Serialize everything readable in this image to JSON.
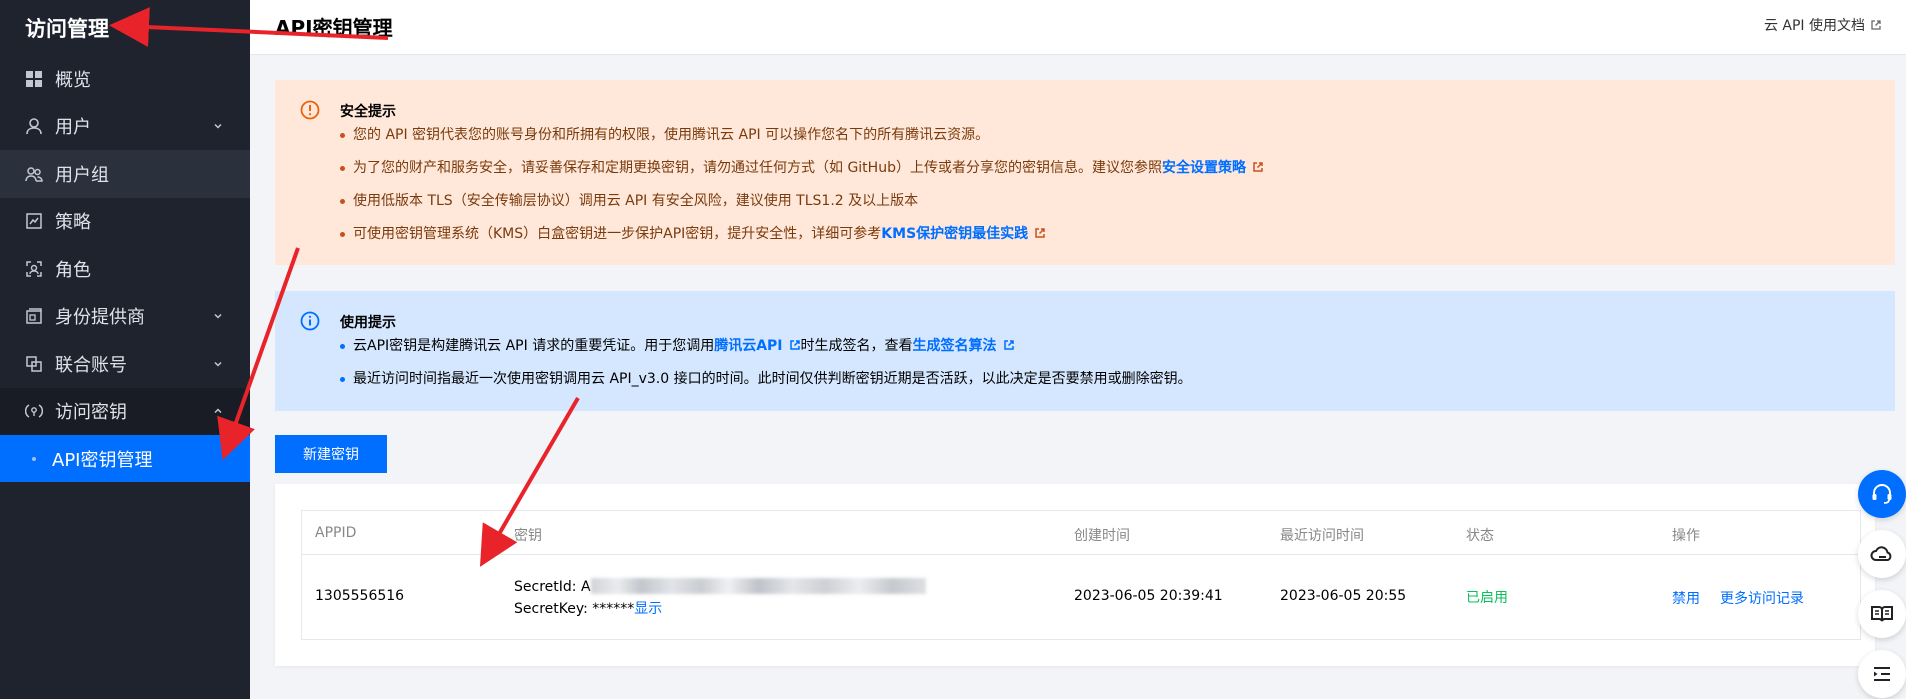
{
  "sidebar": {
    "title": "访问管理",
    "items": [
      {
        "label": "概览"
      },
      {
        "label": "用户"
      },
      {
        "label": "用户组"
      },
      {
        "label": "策略"
      },
      {
        "label": "角色"
      },
      {
        "label": "身份提供商"
      },
      {
        "label": "联合账号"
      },
      {
        "label": "访问密钥"
      }
    ],
    "subitem": {
      "label": "API密钥管理"
    }
  },
  "header": {
    "title": "API密钥管理",
    "doc_link": "云 API 使用文档"
  },
  "security_alert": {
    "title": "安全提示",
    "items": [
      {
        "text": "您的 API 密钥代表您的账号身份和所拥有的权限，使用腾讯云 API 可以操作您名下的所有腾讯云资源。"
      },
      {
        "text": "为了您的财产和服务安全，请妥善保存和定期更换密钥，请勿通过任何方式（如 GitHub）上传或者分享您的密钥信息。建议您参照",
        "link": "安全设置策略"
      },
      {
        "text": "使用低版本 TLS（安全传输层协议）调用云 API 有安全风险，建议使用 TLS1.2 及以上版本"
      },
      {
        "text": "可使用密钥管理系统（KMS）白盒密钥进一步保护API密钥，提升安全性，详细可参考",
        "link": "KMS保护密钥最佳实践"
      }
    ]
  },
  "usage_alert": {
    "title": "使用提示",
    "item1": {
      "prefix": "云API密钥是构建腾讯云 API 请求的重要凭证。用于您调用",
      "link1": "腾讯云API",
      "middle": "时生成签名，查看",
      "link2": "生成签名算法"
    },
    "item2": {
      "text": "最近访问时间指最近一次使用密钥调用云 API_v3.0 接口的时间。此时间仅供判断密钥近期是否活跃，以此决定是否要禁用或删除密钥。"
    }
  },
  "new_key_button": "新建密钥",
  "table": {
    "columns": [
      "APPID",
      "密钥",
      "创建时间",
      "最近访问时间",
      "状态",
      "操作"
    ],
    "row": {
      "appid": "1305556516",
      "secret_id_label": "SecretId: ",
      "secret_id_prefix": "A",
      "secret_key_label": "SecretKey: ",
      "secret_key_mask": "******",
      "show_link": "显示",
      "created": "2023-06-05 20:39:41",
      "last_access": "2023-06-05 20:55",
      "status": "已启用",
      "action_disable": "禁用",
      "action_more": "更多访问记录"
    }
  },
  "colors": {
    "primary": "#006eff",
    "sidebar_bg": "#1f232e",
    "warn_bg": "#ffe8d9",
    "info_bg": "#d5e7ff",
    "status_green": "#0abf5b",
    "annotation_red": "#e8232a"
  }
}
